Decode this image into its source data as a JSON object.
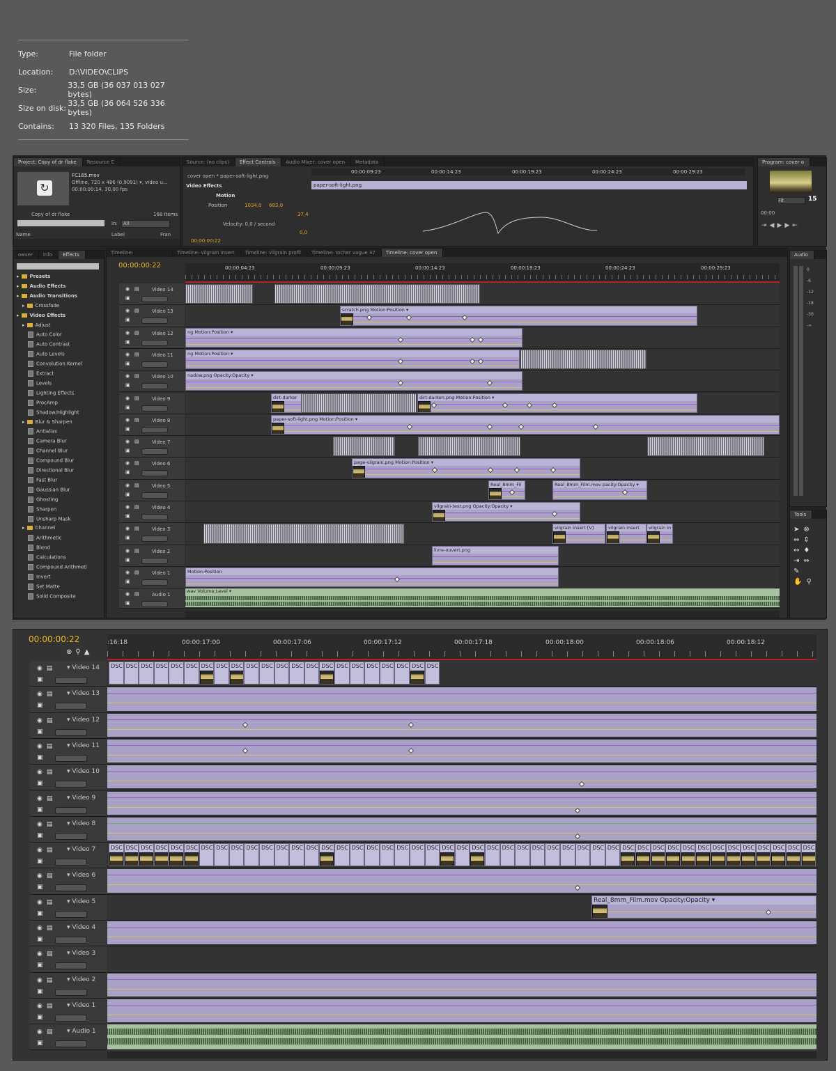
{
  "properties": [
    {
      "key": "Type:",
      "value": "File folder"
    },
    {
      "key": "Location:",
      "value": "D:\\VIDEO\\CLIPS"
    },
    {
      "key": "Size:",
      "value": "33,5 GB (36 037 013 027 bytes)"
    },
    {
      "key": "Size on disk:",
      "value": "33,5 GB (36 064 526 336 bytes)"
    },
    {
      "key": "Contains:",
      "value": "13 320 Files, 135 Folders"
    }
  ],
  "project": {
    "tab_project": "Project: Copy of dr flake",
    "tab_resource": "Resource C",
    "file_name": "FC165.mov",
    "file_info1": "Offline, 720 x 486 (0,9091)",
    "file_info1b": ", video u...",
    "file_info2": "00:00:00:14, 30,00 fps",
    "project_name": "Copy of dr flake",
    "items": "168 Items",
    "in_label": "In:",
    "in_value": "All",
    "col_name": "Name",
    "col_label": "Label",
    "col_frame": "Fran"
  },
  "effect_controls": {
    "tab_source": "Source: (no clips)",
    "tab_effect": "Effect Controls",
    "tab_mixer": "Audio Mixer: cover open",
    "tab_meta": "Metadata",
    "clip_path": "cover open * paper-soft-light.png",
    "section": "Video Effects",
    "motion": "Motion",
    "position": "Position",
    "pos_x": "1034,0",
    "pos_y": "683,0",
    "val1": "37,4",
    "velocity": "Velocity: 0,0 / second",
    "val2": "0,0",
    "time": "00:00:00:22",
    "clip_bar": "paper-soft-light.png",
    "ruler": [
      "00:00:09:23",
      "00:00:14:23",
      "00:00:19:23",
      "00:00:24:23",
      "00:00:29:23"
    ]
  },
  "program": {
    "tab": "Program: cover o",
    "fit": "Fit",
    "num": "15",
    "tc": "00:00"
  },
  "effects_panel": {
    "tabs": [
      "owser",
      "Info",
      "Effects"
    ],
    "tree": [
      {
        "label": "Presets",
        "lvl": 0,
        "kind": "folder",
        "bold": true
      },
      {
        "label": "Audio Effects",
        "lvl": 0,
        "kind": "folder",
        "bold": true
      },
      {
        "label": "Audio Transitions",
        "lvl": 0,
        "kind": "folder",
        "bold": true
      },
      {
        "label": "Crossfade",
        "lvl": 1,
        "kind": "folder"
      },
      {
        "label": "Video Effects",
        "lvl": 0,
        "kind": "folder",
        "bold": true
      },
      {
        "label": "Adjust",
        "lvl": 1,
        "kind": "folder"
      },
      {
        "label": "Auto Color",
        "lvl": 2,
        "kind": "fx"
      },
      {
        "label": "Auto Contrast",
        "lvl": 2,
        "kind": "fx"
      },
      {
        "label": "Auto Levels",
        "lvl": 2,
        "kind": "fx"
      },
      {
        "label": "Convolution Kernel",
        "lvl": 2,
        "kind": "fx"
      },
      {
        "label": "Extract",
        "lvl": 2,
        "kind": "fx"
      },
      {
        "label": "Levels",
        "lvl": 2,
        "kind": "fx"
      },
      {
        "label": "Lighting Effects",
        "lvl": 2,
        "kind": "fx"
      },
      {
        "label": "ProcAmp",
        "lvl": 2,
        "kind": "fx"
      },
      {
        "label": "Shadow/Highlight",
        "lvl": 2,
        "kind": "fx"
      },
      {
        "label": "Blur & Sharpen",
        "lvl": 1,
        "kind": "folder"
      },
      {
        "label": "Antialias",
        "lvl": 2,
        "kind": "fx"
      },
      {
        "label": "Camera Blur",
        "lvl": 2,
        "kind": "fx"
      },
      {
        "label": "Channel Blur",
        "lvl": 2,
        "kind": "fx"
      },
      {
        "label": "Compound Blur",
        "lvl": 2,
        "kind": "fx"
      },
      {
        "label": "Directional Blur",
        "lvl": 2,
        "kind": "fx"
      },
      {
        "label": "Fast Blur",
        "lvl": 2,
        "kind": "fx"
      },
      {
        "label": "Gaussian Blur",
        "lvl": 2,
        "kind": "fx"
      },
      {
        "label": "Ghosting",
        "lvl": 2,
        "kind": "fx"
      },
      {
        "label": "Sharpen",
        "lvl": 2,
        "kind": "fx"
      },
      {
        "label": "Unsharp Mask",
        "lvl": 2,
        "kind": "fx"
      },
      {
        "label": "Channel",
        "lvl": 1,
        "kind": "folder"
      },
      {
        "label": "Arithmetic",
        "lvl": 2,
        "kind": "fx"
      },
      {
        "label": "Blend",
        "lvl": 2,
        "kind": "fx"
      },
      {
        "label": "Calculations",
        "lvl": 2,
        "kind": "fx"
      },
      {
        "label": "Compound Arithmeti",
        "lvl": 2,
        "kind": "fx"
      },
      {
        "label": "Invert",
        "lvl": 2,
        "kind": "fx"
      },
      {
        "label": "Set Matte",
        "lvl": 2,
        "kind": "fx"
      },
      {
        "label": "Solid Composite",
        "lvl": 2,
        "kind": "fx"
      }
    ]
  },
  "timeline": {
    "tabs": [
      "Timeline:",
      "Timeline: vilgrain insert",
      "Timeline: vilgrain profil",
      "Timeline: rocher vague 37",
      "Timeline: cover open"
    ],
    "time": "00:00:00:22",
    "ruler": [
      "00:00:04:23",
      "00:00:09:23",
      "00:00:14:23",
      "00:00:19:23",
      "00:00:24:23",
      "00:00:29:23"
    ],
    "tracks": [
      "Video 14",
      "Video 13",
      "Video 12",
      "Video 11",
      "Video 10",
      "Video 9",
      "Video 8",
      "Video 7",
      "Video 6",
      "Video 5",
      "Video 4",
      "Video 3",
      "Video 2",
      "Video 1",
      "Audio 1"
    ],
    "clips": {
      "scratch": "scratch.png",
      "motion_pos": "Motion:Position",
      "ng": "ng",
      "nadow": "nadow.png",
      "opacity": "Opacity:Opacity",
      "dirt_darker": "dirt-darker",
      "dirt_darken": "dirt-darken.png",
      "paper": "paper-soft-light.png",
      "page": "page-vilgrain.png",
      "real1": "Real_8mm_Fil",
      "real2": "Real_8mm_Film.mov",
      "pacity": "pacity:Opacity",
      "vtest": "vilgrain-test.png",
      "vins1": "vilgrain insert [V]",
      "vins2": "vilgrain insert",
      "vins3": "vilgrain in",
      "livre": "livre-ouvert.png",
      "wav": "wav",
      "volume": "Volume:Level"
    }
  },
  "audio_panel": {
    "tab": "Audio",
    "levels": [
      "0",
      "-6",
      "-12",
      "-18",
      "-30",
      "-∞"
    ]
  },
  "tools_panel": {
    "tab": "Tools"
  },
  "zoom_timeline": {
    "time": "00:00:00:22",
    "ruler": [
      ":16:18",
      "00:00:17:00",
      "00:00:17:06",
      "00:00:17:12",
      "00:00:17:18",
      "00:00:18:00",
      "00:00:18:06",
      "00:00:18:12"
    ],
    "tracks": [
      "Video 14",
      "Video 13",
      "Video 12",
      "Video 11",
      "Video 10",
      "Video 9",
      "Video 8",
      "Video 7",
      "Video 6",
      "Video 5",
      "Video 4",
      "Video 3",
      "Video 2",
      "Video 1",
      "Audio 1"
    ],
    "dsc": "DSC",
    "real": "Real_8mm_Film.mov",
    "opacity": "Opacity:Opacity"
  }
}
